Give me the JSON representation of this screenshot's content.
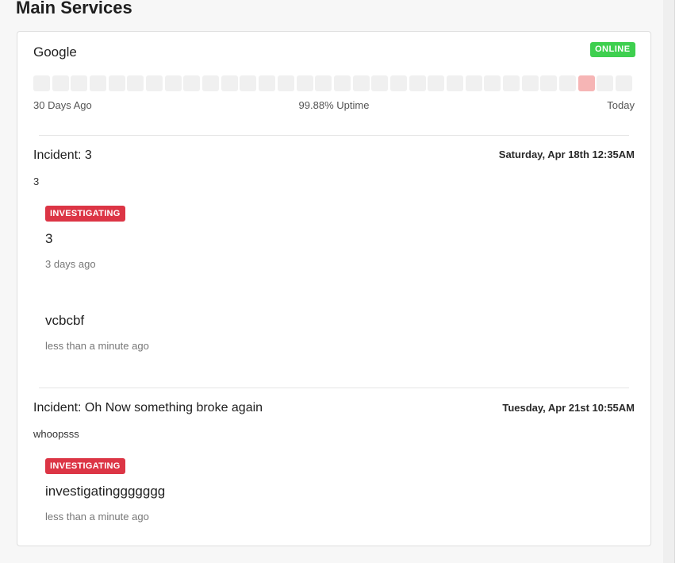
{
  "section": {
    "title": "Main Services"
  },
  "service": {
    "name": "Google",
    "status": "ONLINE",
    "status_color": "#3ecf4f",
    "uptime": {
      "days": [
        "up",
        "up",
        "up",
        "up",
        "up",
        "up",
        "up",
        "up",
        "up",
        "up",
        "up",
        "up",
        "up",
        "up",
        "up",
        "up",
        "up",
        "up",
        "up",
        "up",
        "up",
        "up",
        "up",
        "up",
        "up",
        "up",
        "up",
        "up",
        "up",
        "down",
        "up",
        "up"
      ],
      "left_label": "30 Days Ago",
      "center_label": "99.88% Uptime",
      "right_label": "Today"
    }
  },
  "incidents": [
    {
      "title": "Incident: 3",
      "date": "Saturday, Apr 18th 12:35AM",
      "description": "3",
      "updates": [
        {
          "status": "INVESTIGATING",
          "message": "3",
          "time": "3 days ago"
        },
        {
          "status": "",
          "message": "vcbcbf",
          "time": "less than a minute ago"
        }
      ]
    },
    {
      "title": "Incident: Oh Now something broke again",
      "date": "Tuesday, Apr 21st 10:55AM",
      "description": "whoopsss",
      "updates": [
        {
          "status": "INVESTIGATING",
          "message": "investigatinggggggg",
          "time": "less than a minute ago"
        }
      ]
    }
  ],
  "colors": {
    "investigating": "#dc3545",
    "uptime_ok": "#f0f0f0",
    "uptime_down": "#f6b5b5"
  }
}
